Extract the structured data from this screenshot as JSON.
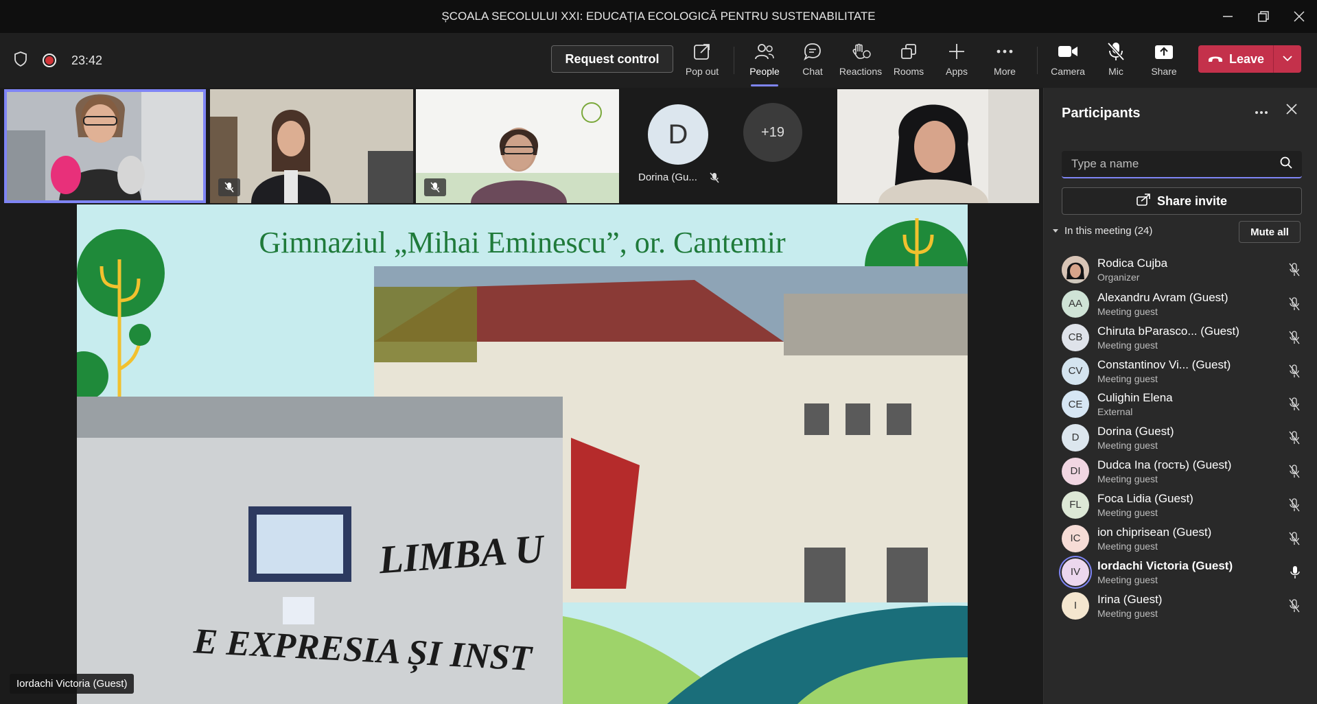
{
  "window": {
    "title": "ȘCOALA SECOLULUI XXI: EDUCAȚIA ECOLOGICĂ PENTRU SUSTENABILITATE"
  },
  "toolbar": {
    "timer": "23:42",
    "request_control": "Request control",
    "items": [
      {
        "label": "Pop out",
        "icon": "pop-out-icon"
      },
      {
        "label": "People",
        "icon": "people-icon"
      },
      {
        "label": "Chat",
        "icon": "chat-icon"
      },
      {
        "label": "Reactions",
        "icon": "reactions-icon"
      },
      {
        "label": "Rooms",
        "icon": "rooms-icon"
      },
      {
        "label": "Apps",
        "icon": "apps-icon"
      },
      {
        "label": "More",
        "icon": "more-icon"
      },
      {
        "label": "Camera",
        "icon": "camera-icon"
      },
      {
        "label": "Mic",
        "icon": "mic-off-icon"
      },
      {
        "label": "Share",
        "icon": "share-icon"
      }
    ],
    "leave": "Leave"
  },
  "stage": {
    "tiles": {
      "dorina_label": "Dorina (Gu...",
      "dorina_initial": "D",
      "overflow": "+19"
    },
    "slide_title": "Gimnaziul „Mihai Eminescu”, or. Cantemir",
    "wall_text_1": "LIMBA U",
    "wall_text_2": "E EXPRESIA ȘI INST",
    "speaker_name": "Iordachi Victoria (Guest)"
  },
  "panel": {
    "title": "Participants",
    "search_placeholder": "Type a name",
    "share_invite": "Share invite",
    "in_meeting": "In this meeting (24)",
    "mute_all": "Mute all",
    "participants": [
      {
        "initials": "",
        "name": "Rodica Cujba",
        "role": "Organizer",
        "color": "#c9b2a6",
        "photo": true
      },
      {
        "initials": "AA",
        "name": "Alexandru Avram (Guest)",
        "role": "Meeting guest",
        "color": "#cfe3d6"
      },
      {
        "initials": "CB",
        "name": "Chiruta bParasco... (Guest)",
        "role": "Meeting guest",
        "color": "#dfe3ea"
      },
      {
        "initials": "CV",
        "name": "Constantinov Vi... (Guest)",
        "role": "Meeting guest",
        "color": "#d4e4ef"
      },
      {
        "initials": "CE",
        "name": "Culighin Elena",
        "role": "External",
        "color": "#d6e6f4"
      },
      {
        "initials": "D",
        "name": "Dorina (Guest)",
        "role": "Meeting guest",
        "color": "#dce6ee"
      },
      {
        "initials": "DI",
        "name": "Dudca Ina (гость) (Guest)",
        "role": "Meeting guest",
        "color": "#f1d6e2"
      },
      {
        "initials": "FL",
        "name": "Foca Lidia (Guest)",
        "role": "Meeting guest",
        "color": "#dde8d6"
      },
      {
        "initials": "IC",
        "name": "ion chiprisean (Guest)",
        "role": "Meeting guest",
        "color": "#f6dcd6"
      },
      {
        "initials": "IV",
        "name": "Iordachi Victoria (Guest)",
        "role": "Meeting guest",
        "color": "#ecd7ee",
        "speaking": true
      },
      {
        "initials": "I",
        "name": "Irina (Guest)",
        "role": "Meeting guest",
        "color": "#f4e6cf"
      }
    ]
  },
  "colors": {
    "accent": "#7f85f5",
    "leave": "#c4314b",
    "slide_bg": "#c7ecee",
    "tree_green": "#1f8a3a"
  }
}
